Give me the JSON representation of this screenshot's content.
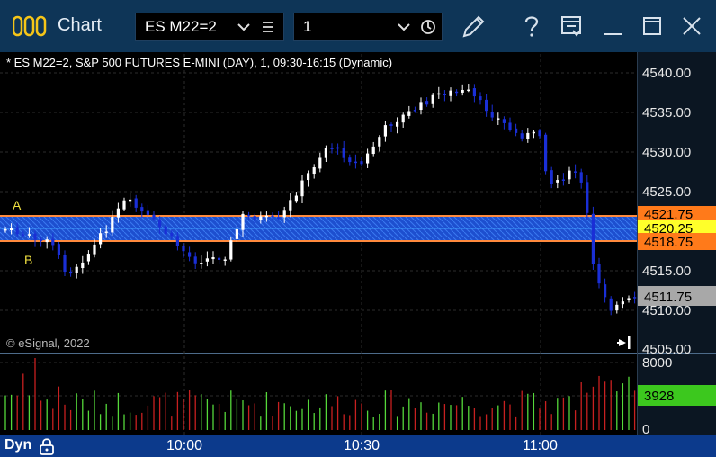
{
  "window": {
    "title": "Chart",
    "symbol_combo": "ES M22=2",
    "interval_combo": "1"
  },
  "chart": {
    "header": "* ES M22=2, S&P 500 FUTURES E-MINI (DAY), 1, 09:30-16:15 (Dynamic)",
    "watermark": "© eSignal, 2022",
    "price_axis_labels": [
      "4540.00",
      "4535.00",
      "4530.00",
      "4525.00",
      "4515.00",
      "4510.00",
      "4505.00"
    ],
    "markers": {
      "a": "A",
      "b": "B"
    },
    "price_tags": {
      "upper": "4521.75",
      "mid": "4520.25",
      "lower": "4518.75",
      "last": "4511.75"
    },
    "volume_axis": {
      "max": "8000",
      "current": "3928",
      "min": "0"
    },
    "time_labels": [
      "10:00",
      "10:30",
      "11:00"
    ]
  },
  "statusbar": {
    "label": "Dyn"
  },
  "colors": {
    "title_bg": "#0e3557",
    "status_bg": "#0c3a8c",
    "band_blue": "#2b6fe8",
    "band_border": "#ff8a3d",
    "up_candle": "#ffffff",
    "down_candle": "#1a2fd6",
    "vol_up": "#55d83a",
    "vol_down": "#c82020",
    "volume_tag": "#3cc81e",
    "upper_tag": "#ff7a1a",
    "mid_tag": "#ffff2a",
    "last_tag": "#a8a8a8"
  },
  "icons": [
    "logo-icon",
    "dropdown-arrow-icon",
    "menu-lines-icon",
    "clock-icon",
    "pencil-icon",
    "help-icon",
    "layout-icon",
    "minimize-icon",
    "maximize-icon",
    "close-icon",
    "scroll-right-icon",
    "lock-icon"
  ]
}
